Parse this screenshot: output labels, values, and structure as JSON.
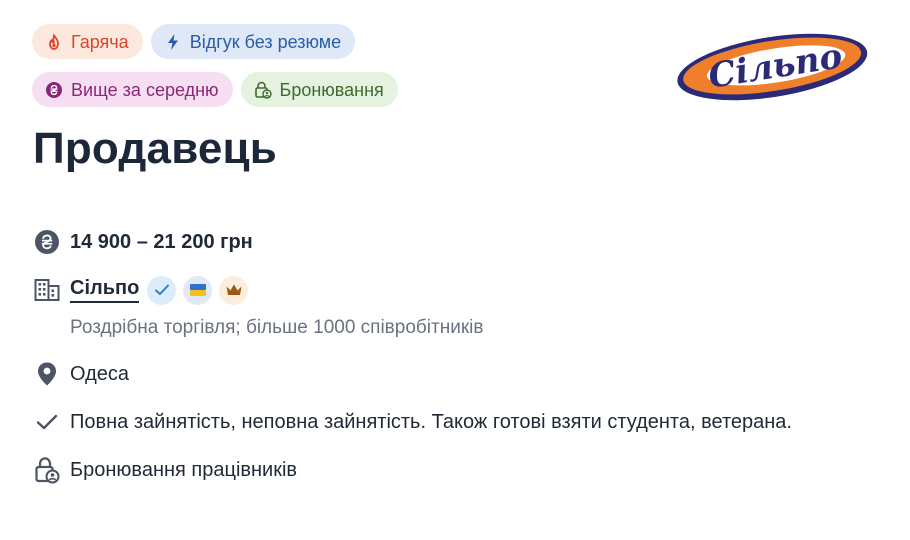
{
  "badges": {
    "hot": "Гаряча",
    "fast_apply": "Відгук без резюме",
    "above_average": "Вище за середню",
    "reservation": "Бронювання"
  },
  "logo": {
    "text": "Сільпо",
    "colors": {
      "orange": "#f07f2b",
      "navy": "#2b2a78"
    }
  },
  "job": {
    "title": "Продавець",
    "salary": "14 900 – 21 200 грн",
    "company": {
      "name": "Сільпо",
      "badges": [
        "verified-icon",
        "ukraine-flag-icon",
        "crown-icon"
      ],
      "description": "Роздрібна торгівля; більше 1000 співробітників"
    },
    "location": "Одеса",
    "employment": "Повна зайнятість, неповна зайнятість. Також готові взяти студента, ветерана.",
    "reservation_info": "Бронювання працівників"
  },
  "icons": {
    "salary": "hryvnia-icon",
    "company": "office-building-icon",
    "location": "map-pin-icon",
    "employment": "checkmark-icon",
    "reservation": "lock-person-icon"
  }
}
